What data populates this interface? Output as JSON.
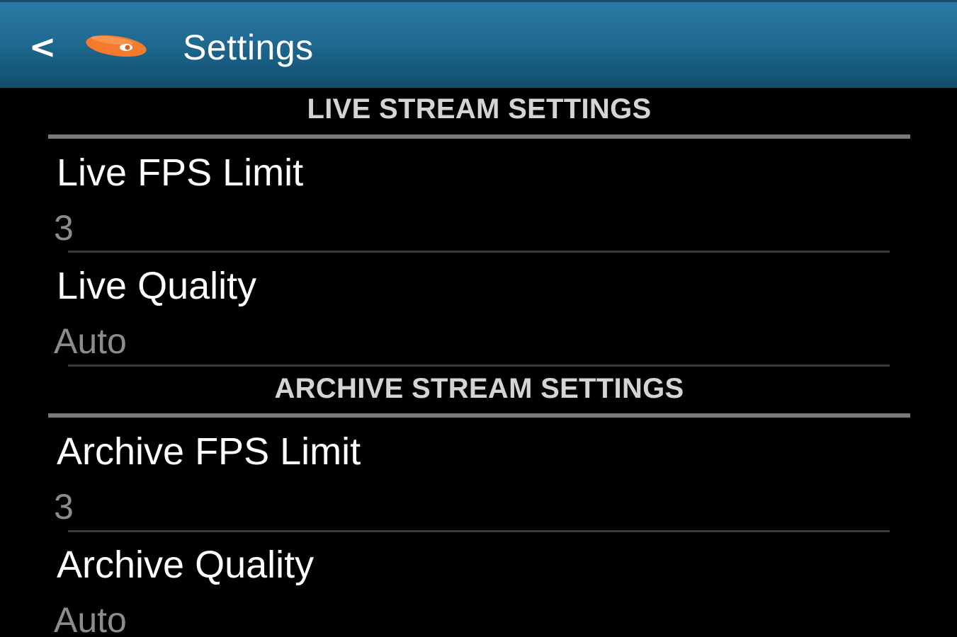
{
  "action_bar": {
    "back_glyph": "<",
    "title": "Settings",
    "logo_icon": "orange-eye-logo"
  },
  "colors": {
    "action_bar": "#1f6a92",
    "background": "#000000",
    "logo_orange": "#f47a2e",
    "summary_gray": "#8c8c8c"
  },
  "sections": [
    {
      "header": "LIVE STREAM SETTINGS",
      "items": [
        {
          "title": "Live FPS Limit",
          "summary": "3"
        },
        {
          "title": "Live Quality",
          "summary": "Auto"
        }
      ]
    },
    {
      "header": "ARCHIVE STREAM SETTINGS",
      "items": [
        {
          "title": "Archive FPS Limit",
          "summary": "3"
        },
        {
          "title": "Archive Quality",
          "summary": "Auto"
        }
      ]
    }
  ]
}
